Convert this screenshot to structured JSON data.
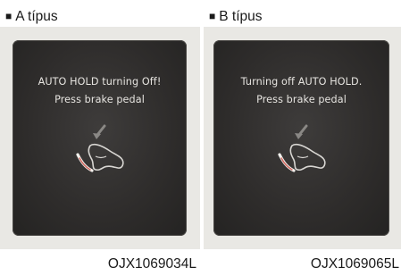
{
  "panels": [
    {
      "heading_bullet": "■",
      "heading": "A típus",
      "message_line1": "AUTO HOLD turning Off!",
      "message_line2": "Press brake pedal",
      "image_code": "OJX1069034L"
    },
    {
      "heading_bullet": "■",
      "heading": "B típus",
      "message_line1": "Turning off AUTO HOLD.",
      "message_line2": "Press brake pedal",
      "image_code": "OJX1069065L"
    }
  ],
  "icons": {
    "pedal": "brake-pedal-icon"
  },
  "colors": {
    "background_gray": "#e9e8e4",
    "display_dark": "#2e2c2b",
    "display_text": "#e6e4e0"
  }
}
